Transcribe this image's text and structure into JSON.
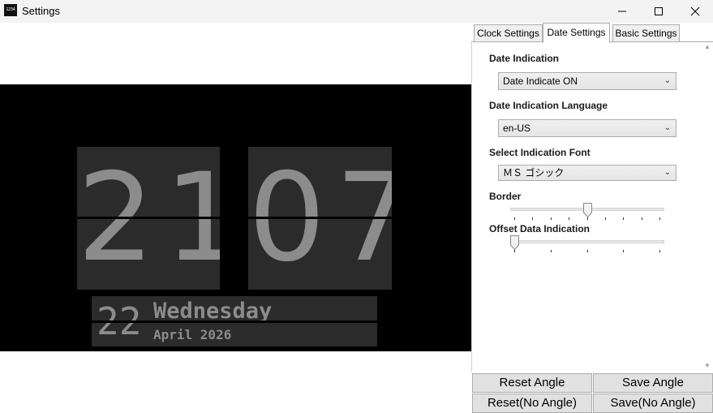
{
  "window": {
    "title": "Settings",
    "icon_text": "1234",
    "controls": {
      "minimize": "minimize",
      "maximize": "maximize",
      "close": "close"
    }
  },
  "preview": {
    "hour": "21",
    "minute": "07",
    "day": "22",
    "weekday": "Wednesday",
    "month_year": "April 2026",
    "background_color": "#000000",
    "card_color": "#2b2b2b",
    "digit_color": "#8c8c8c"
  },
  "tabs": [
    {
      "label": "Clock Settings",
      "active": false
    },
    {
      "label": "Date Settings",
      "active": true
    },
    {
      "label": "Basic Settings",
      "active": false
    }
  ],
  "date_settings": {
    "date_indication": {
      "label": "Date Indication",
      "value": "Date Indicate ON"
    },
    "language": {
      "label": "Date Indication Language",
      "value": "en-US"
    },
    "font": {
      "label": "Select Indication Font",
      "value": "ＭＳ ゴシック"
    },
    "border": {
      "label": "Border",
      "value_fraction": 0.5,
      "tick_count": 9
    },
    "offset": {
      "label": "Offset Data Indication",
      "value_fraction": 0.0,
      "tick_count": 5
    }
  },
  "buttons": {
    "reset_angle": "Reset Angle",
    "save_angle": "Save Angle",
    "reset_no_angle": "Reset(No Angle)",
    "save_no_angle": "Save(No Angle)"
  }
}
